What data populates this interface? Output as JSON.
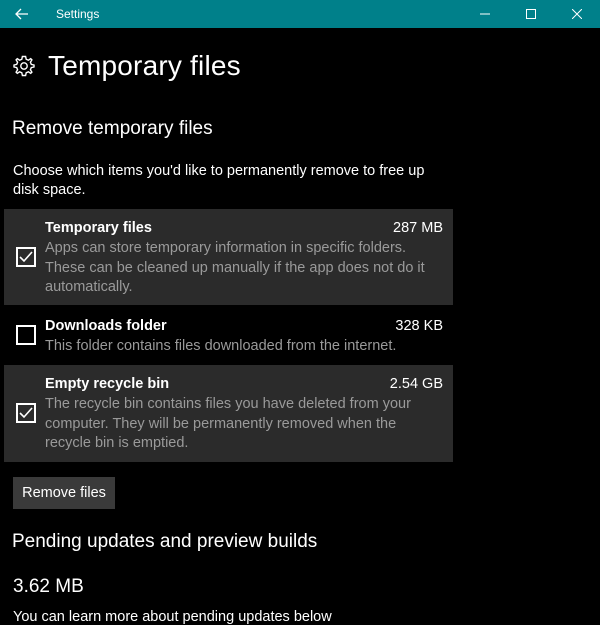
{
  "window": {
    "app_title": "Settings"
  },
  "header": {
    "title": "Temporary files",
    "icon": "gear-icon"
  },
  "remove_section": {
    "title": "Remove temporary files",
    "description": "Choose which items you'd like to permanently remove to free up disk space.",
    "items": [
      {
        "name": "Temporary files",
        "size": "287 MB",
        "description": "Apps can store temporary information in specific folders. These can be cleaned up manually if the app does not do it automatically.",
        "checked": true
      },
      {
        "name": "Downloads folder",
        "size": "328 KB",
        "description": "This folder contains files downloaded from the internet.",
        "checked": false
      },
      {
        "name": "Empty recycle bin",
        "size": "2.54 GB",
        "description": "The recycle bin contains files you have deleted from your computer. They will be permanently removed when the recycle bin is emptied.",
        "checked": true
      }
    ],
    "remove_button_label": "Remove files"
  },
  "pending_section": {
    "title": "Pending updates and preview builds",
    "size": "3.62 MB",
    "footer_text": "You can learn more about pending updates below"
  },
  "colors": {
    "titlebar": "#00808a",
    "background": "#000000",
    "item_highlight": "#2b2b2b",
    "secondary_text": "#9a9a9a",
    "button_bg": "#3a3a3a"
  }
}
